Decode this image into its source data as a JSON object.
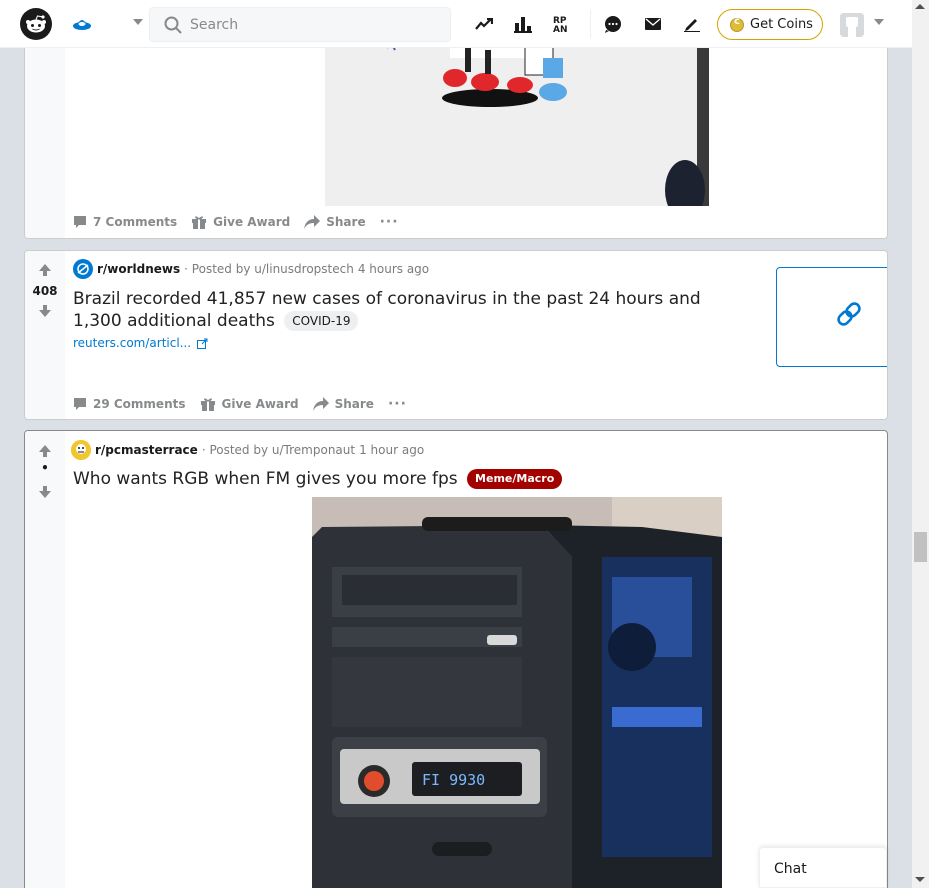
{
  "header": {
    "search_placeholder": "Search",
    "coins_label": "Get Coins",
    "icons": [
      "trending-icon",
      "stats-icon",
      "rpan-icon",
      "chat-icon",
      "mail-icon",
      "pencil-icon"
    ]
  },
  "posts": [
    {
      "comments": "7 Comments",
      "give_award": "Give Award",
      "share": "Share",
      "more": "···"
    },
    {
      "score": "408",
      "subreddit": "r/worldnews",
      "posted_by": "· Posted by u/linusdropstech",
      "time": "4 hours ago",
      "title": "Brazil recorded 41,857 new cases of coronavirus in the past 24 hours and 1,300 additional deaths",
      "flair": "COVID-19",
      "link": "reuters.com/articl...",
      "comments": "29 Comments",
      "give_award": "Give Award",
      "share": "Share",
      "more": "···"
    },
    {
      "score": "•",
      "subreddit": "r/pcmasterrace",
      "posted_by": "· Posted by u/Tremponaut",
      "time": "1 hour ago",
      "title": "Who wants RGB when FM gives you more fps",
      "flair": "Meme/Macro",
      "radio_display": "FI  9930"
    }
  ],
  "chat_label": "Chat",
  "colors": {
    "accent": "#0079d3",
    "meme_flair": "#a30000",
    "coin_border": "#d3a400"
  }
}
